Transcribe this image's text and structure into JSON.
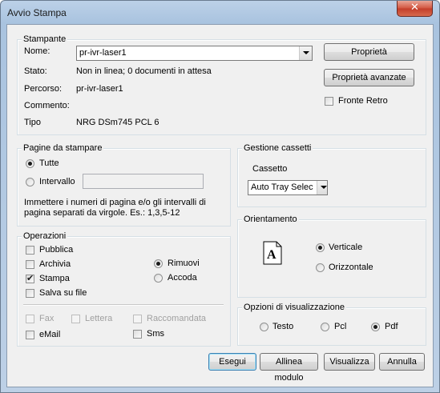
{
  "window": {
    "title": "Avvio Stampa",
    "close_glyph": "✕"
  },
  "stampante": {
    "legend": "Stampante",
    "nome_label": "Nome:",
    "nome_value": "pr-ivr-laser1",
    "stato_label": "Stato:",
    "stato_value": "Non in linea; 0 documenti in attesa",
    "percorso_label": "Percorso:",
    "percorso_value": "pr-ivr-laser1",
    "commento_label": "Commento:",
    "commento_value": "",
    "tipo_label": "Tipo",
    "tipo_value": "NRG DSm745 PCL 6",
    "proprieta_button": "Proprietà",
    "proprieta_avanzate_button": "Proprietà avanzate",
    "fronte_retro_label": "Fronte Retro",
    "fronte_retro_checked": false
  },
  "pagine": {
    "legend": "Pagine da stampare",
    "tutte_label": "Tutte",
    "intervallo_label": "Intervallo",
    "intervallo_value": "",
    "selected": "Tutte",
    "hint": "Immettere i numeri di pagina e/o gli intervalli di pagina separati da virgole. Es.: 1,3,5-12"
  },
  "operazioni": {
    "legend": "Operazioni",
    "pubblica": "Pubblica",
    "archivia": "Archivia",
    "stampa": "Stampa",
    "stampa_checked": true,
    "salva": "Salva su file",
    "rimuovi": "Rimuovi",
    "accoda": "Accoda",
    "selected": "Rimuovi",
    "fax": "Fax",
    "lettera": "Lettera",
    "raccomandata": "Raccomandata",
    "email": "eMail",
    "sms": "Sms"
  },
  "cassetti": {
    "legend": "Gestione cassetti",
    "cassetto_label": "Cassetto",
    "cassetto_value": "Auto Tray Selec"
  },
  "orientamento": {
    "legend": "Orientamento",
    "icon_letter": "A",
    "verticale": "Verticale",
    "orizzontale": "Orizzontale",
    "selected": "Verticale"
  },
  "visualizzazione": {
    "legend": "Opzioni di visualizzazione",
    "testo": "Testo",
    "pcl": "Pcl",
    "pdf": "Pdf",
    "selected": "Pdf"
  },
  "footer": {
    "esegui": "Esegui",
    "allinea": "Allinea modulo",
    "visualizza": "Visualizza",
    "annulla": "Annulla"
  }
}
